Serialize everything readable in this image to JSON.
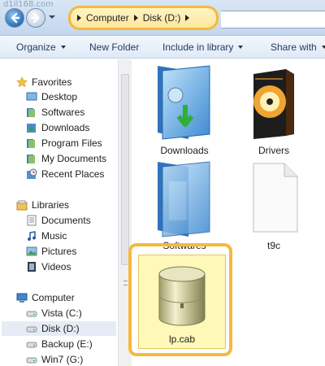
{
  "watermark": "d1il168.com",
  "address_bar": {
    "breadcrumb": [
      "Computer",
      "Disk (D:)"
    ]
  },
  "toolbar": {
    "organize": "Organize",
    "new_folder": "New Folder",
    "include_in_library": "Include in library",
    "share_with": "Share with"
  },
  "sidebar": {
    "favorites_header": "Favorites",
    "favorites": [
      {
        "label": "Desktop",
        "icon": "desktop-icon"
      },
      {
        "label": "Softwares",
        "icon": "folder-icon"
      },
      {
        "label": "Downloads",
        "icon": "downloads-icon"
      },
      {
        "label": "Program Files",
        "icon": "folder-icon"
      },
      {
        "label": "My Documents",
        "icon": "folder-icon"
      },
      {
        "label": "Recent Places",
        "icon": "recent-places-icon"
      }
    ],
    "libraries_header": "Libraries",
    "libraries": [
      {
        "label": "Documents",
        "icon": "documents-icon"
      },
      {
        "label": "Music",
        "icon": "music-icon"
      },
      {
        "label": "Pictures",
        "icon": "pictures-icon"
      },
      {
        "label": "Videos",
        "icon": "videos-icon"
      }
    ],
    "computer_header": "Computer",
    "drives": [
      {
        "label": "Vista (C:)",
        "icon": "drive-icon"
      },
      {
        "label": "Disk (D:)",
        "icon": "drive-icon",
        "selected": true
      },
      {
        "label": "Backup (E:)",
        "icon": "drive-icon"
      },
      {
        "label": "Win7 (G:)",
        "icon": "drive-icon"
      }
    ]
  },
  "files": [
    {
      "name": "Downloads",
      "icon": "downloads-folder-icon"
    },
    {
      "name": "Drivers",
      "icon": "drivers-box-icon"
    },
    {
      "name": "Softwares",
      "icon": "folder-icon"
    },
    {
      "name": "t9c",
      "icon": "blank-file-icon"
    },
    {
      "name": "lp.cab",
      "icon": "cab-archive-icon",
      "selected": true
    }
  ],
  "colors": {
    "highlight_ring": "#f5b93c",
    "selection_fill": "#fff8b8",
    "toolbar_text": "#1e3a5f"
  }
}
